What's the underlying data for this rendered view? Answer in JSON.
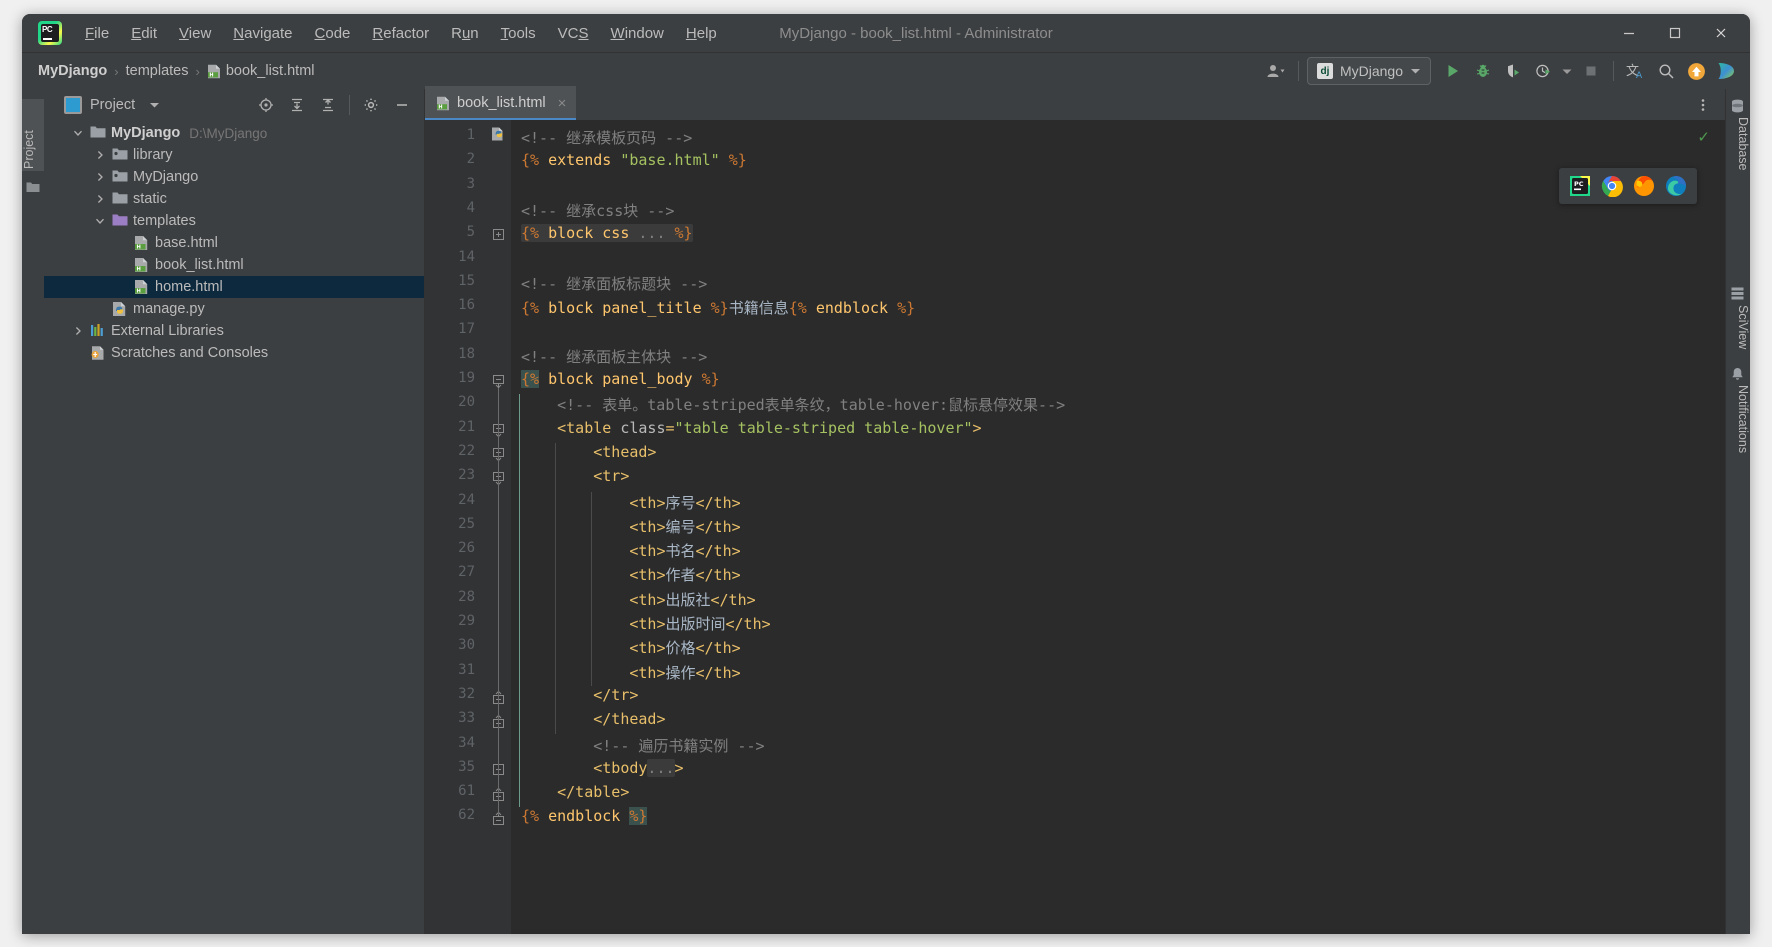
{
  "window": {
    "title": "MyDjango - book_list.html - Administrator",
    "controls": [
      "minimize",
      "maximize",
      "close"
    ],
    "logo_text": "PC"
  },
  "menu": {
    "items": [
      {
        "label": "File",
        "mnemonic": "F"
      },
      {
        "label": "Edit",
        "mnemonic": "E"
      },
      {
        "label": "View",
        "mnemonic": "V"
      },
      {
        "label": "Navigate",
        "mnemonic": "N"
      },
      {
        "label": "Code",
        "mnemonic": "C"
      },
      {
        "label": "Refactor",
        "mnemonic": "R"
      },
      {
        "label": "Run",
        "mnemonic": "u"
      },
      {
        "label": "Tools",
        "mnemonic": "T"
      },
      {
        "label": "VCS",
        "mnemonic": "S"
      },
      {
        "label": "Window",
        "mnemonic": "W"
      },
      {
        "label": "Help",
        "mnemonic": "H"
      }
    ]
  },
  "navbar": {
    "breadcrumbs": [
      {
        "label": "MyDjango",
        "bold": true,
        "icon": null
      },
      {
        "label": "templates",
        "bold": false,
        "icon": null
      },
      {
        "label": "book_list.html",
        "bold": false,
        "icon": "html-file-icon"
      }
    ],
    "run_config": {
      "label": "MyDjango",
      "icon": "django-icon",
      "badge": "dj"
    },
    "buttons": [
      {
        "name": "user-account-button",
        "icon": "user-icon"
      },
      {
        "name": "run-button",
        "icon": "run-play-icon"
      },
      {
        "name": "debug-button",
        "icon": "debug-bug-icon"
      },
      {
        "name": "run-coverage-button",
        "icon": "coverage-icon"
      },
      {
        "name": "profile-button",
        "icon": "profiler-icon"
      },
      {
        "name": "stop-button",
        "icon": "stop-square-icon"
      },
      {
        "name": "translate-button",
        "icon": "translate-icon"
      },
      {
        "name": "search-everywhere-button",
        "icon": "search-icon"
      },
      {
        "name": "update-button",
        "icon": "arrow-up-circle-icon"
      },
      {
        "name": "play-colored-button",
        "icon": "play-gradient-icon"
      }
    ]
  },
  "left_strip": {
    "label": "Project",
    "icon": "folder-icon"
  },
  "project_panel": {
    "title": "Project",
    "toolbar_icons": [
      "locate-icon",
      "expand-all-icon",
      "collapse-all-icon",
      "settings-gear-icon",
      "hide-minus-icon"
    ],
    "tree": [
      {
        "label": "MyDjango",
        "path": "D:\\MyDjango",
        "depth": 0,
        "arrow": "down",
        "icon": "folder-icon",
        "bold": true,
        "selected": false
      },
      {
        "label": "library",
        "path": "",
        "depth": 1,
        "arrow": "right",
        "icon": "module-folder-icon",
        "bold": false,
        "selected": false
      },
      {
        "label": "MyDjango",
        "path": "",
        "depth": 1,
        "arrow": "right",
        "icon": "module-folder-icon",
        "bold": false,
        "selected": false
      },
      {
        "label": "static",
        "path": "",
        "depth": 1,
        "arrow": "right",
        "icon": "folder-icon",
        "bold": false,
        "selected": false
      },
      {
        "label": "templates",
        "path": "",
        "depth": 1,
        "arrow": "down",
        "icon": "templates-folder-icon",
        "bold": false,
        "selected": false
      },
      {
        "label": "base.html",
        "path": "",
        "depth": 2,
        "arrow": "none",
        "icon": "html-file-icon",
        "bold": false,
        "selected": false
      },
      {
        "label": "book_list.html",
        "path": "",
        "depth": 2,
        "arrow": "none",
        "icon": "html-file-icon",
        "bold": false,
        "selected": false
      },
      {
        "label": "home.html",
        "path": "",
        "depth": 2,
        "arrow": "none",
        "icon": "html-file-icon",
        "bold": false,
        "selected": true
      },
      {
        "label": "manage.py",
        "path": "",
        "depth": 1,
        "arrow": "none",
        "icon": "python-file-icon",
        "bold": false,
        "selected": false
      },
      {
        "label": "External Libraries",
        "path": "",
        "depth": 0,
        "arrow": "right",
        "icon": "libraries-icon",
        "bold": false,
        "selected": false
      },
      {
        "label": "Scratches and Consoles",
        "path": "",
        "depth": 0,
        "arrow": "none",
        "icon": "scratches-icon",
        "bold": false,
        "selected": false
      }
    ]
  },
  "editor": {
    "tab": {
      "label": "book_list.html",
      "icon": "html-file-icon",
      "close": "×"
    },
    "more_icon": "more-vertical-icon",
    "inspection_status": "✓",
    "python_console_icon": "python-run-icon",
    "lines": [
      {
        "num": "1",
        "indent": 0,
        "fold": "none",
        "text": "<!-- 继承模板页码 -->",
        "kind": "comment"
      },
      {
        "num": "2",
        "indent": 0,
        "fold": "none",
        "text": "{% extends \"base.html\" %}",
        "kind": "extends"
      },
      {
        "num": "3",
        "indent": 0,
        "fold": "none",
        "text": "",
        "kind": "blank"
      },
      {
        "num": "4",
        "indent": 0,
        "fold": "none",
        "text": "<!-- 继承css块 -->",
        "kind": "comment"
      },
      {
        "num": "5",
        "indent": 0,
        "fold": "collapsed",
        "text": "{% block css ... %}",
        "kind": "folded-block"
      },
      {
        "num": "14",
        "indent": 0,
        "fold": "none",
        "text": "",
        "kind": "blank"
      },
      {
        "num": "15",
        "indent": 0,
        "fold": "none",
        "text": "<!-- 继承面板标题块 -->",
        "kind": "comment"
      },
      {
        "num": "16",
        "indent": 0,
        "fold": "none",
        "text": "{% block panel_title %}书籍信息{% endblock %}",
        "kind": "panel-title"
      },
      {
        "num": "17",
        "indent": 0,
        "fold": "none",
        "text": "",
        "kind": "blank"
      },
      {
        "num": "18",
        "indent": 0,
        "fold": "none",
        "text": "<!-- 继承面板主体块 -->",
        "kind": "comment"
      },
      {
        "num": "19",
        "indent": 0,
        "fold": "open",
        "text": "{% block panel_body %}",
        "kind": "block-body-open"
      },
      {
        "num": "20",
        "indent": 1,
        "fold": "none",
        "text": "<!-- 表单。table-striped表单条纹，table-hover:鼠标悬停效果-->",
        "kind": "comment"
      },
      {
        "num": "21",
        "indent": 1,
        "fold": "open",
        "text": "<table class=\"table table-striped table-hover\">",
        "kind": "table-open"
      },
      {
        "num": "22",
        "indent": 2,
        "fold": "open",
        "text": "<thead>",
        "kind": "tag"
      },
      {
        "num": "23",
        "indent": 2,
        "fold": "open",
        "text": "<tr>",
        "kind": "tag"
      },
      {
        "num": "24",
        "indent": 3,
        "fold": "none",
        "text": "<th>序号</th>",
        "kind": "th"
      },
      {
        "num": "25",
        "indent": 3,
        "fold": "none",
        "text": "<th>编号</th>",
        "kind": "th"
      },
      {
        "num": "26",
        "indent": 3,
        "fold": "none",
        "text": "<th>书名</th>",
        "kind": "th"
      },
      {
        "num": "27",
        "indent": 3,
        "fold": "none",
        "text": "<th>作者</th>",
        "kind": "th"
      },
      {
        "num": "28",
        "indent": 3,
        "fold": "none",
        "text": "<th>出版社</th>",
        "kind": "th"
      },
      {
        "num": "29",
        "indent": 3,
        "fold": "none",
        "text": "<th>出版时间</th>",
        "kind": "th"
      },
      {
        "num": "30",
        "indent": 3,
        "fold": "none",
        "text": "<th>价格</th>",
        "kind": "th"
      },
      {
        "num": "31",
        "indent": 3,
        "fold": "none",
        "text": "<th>操作</th>",
        "kind": "th"
      },
      {
        "num": "32",
        "indent": 2,
        "fold": "close",
        "text": "</tr>",
        "kind": "tag"
      },
      {
        "num": "33",
        "indent": 2,
        "fold": "close",
        "text": "</thead>",
        "kind": "tag"
      },
      {
        "num": "34",
        "indent": 2,
        "fold": "none",
        "text": "<!-- 遍历书籍实例 -->",
        "kind": "comment"
      },
      {
        "num": "35",
        "indent": 2,
        "fold": "collapsed",
        "text": "<tbody...>",
        "kind": "folded-tbody"
      },
      {
        "num": "61",
        "indent": 1,
        "fold": "close",
        "text": "</table>",
        "kind": "tag"
      },
      {
        "num": "62",
        "indent": 0,
        "fold": "close",
        "text": "{% endblock %}",
        "kind": "endblock"
      }
    ],
    "table_headers": [
      "序号",
      "编号",
      "书名",
      "作者",
      "出版社",
      "出版时间",
      "价格",
      "操作"
    ]
  },
  "browser_popup": {
    "icons": [
      "pycharm-icon",
      "chrome-icon",
      "firefox-icon",
      "edge-icon"
    ]
  },
  "right_strip": {
    "items": [
      {
        "label": "Database",
        "icon": "database-icon"
      },
      {
        "label": "SciView",
        "icon": "sciview-icon"
      },
      {
        "label": "Notifications",
        "icon": "notifications-bell-icon"
      }
    ]
  },
  "colors": {
    "accent_blue": "#4a88c7",
    "selection": "#0d293e",
    "editor_bg": "#2b2b2b",
    "panel_bg": "#3c3f41",
    "gutter_bg": "#313335",
    "comment": "#808080",
    "tag": "#e8bf6a",
    "string": "#a5c261",
    "keyword": "#cc7832",
    "django_kw": "#ffc66d",
    "green_run": "#59a869"
  }
}
